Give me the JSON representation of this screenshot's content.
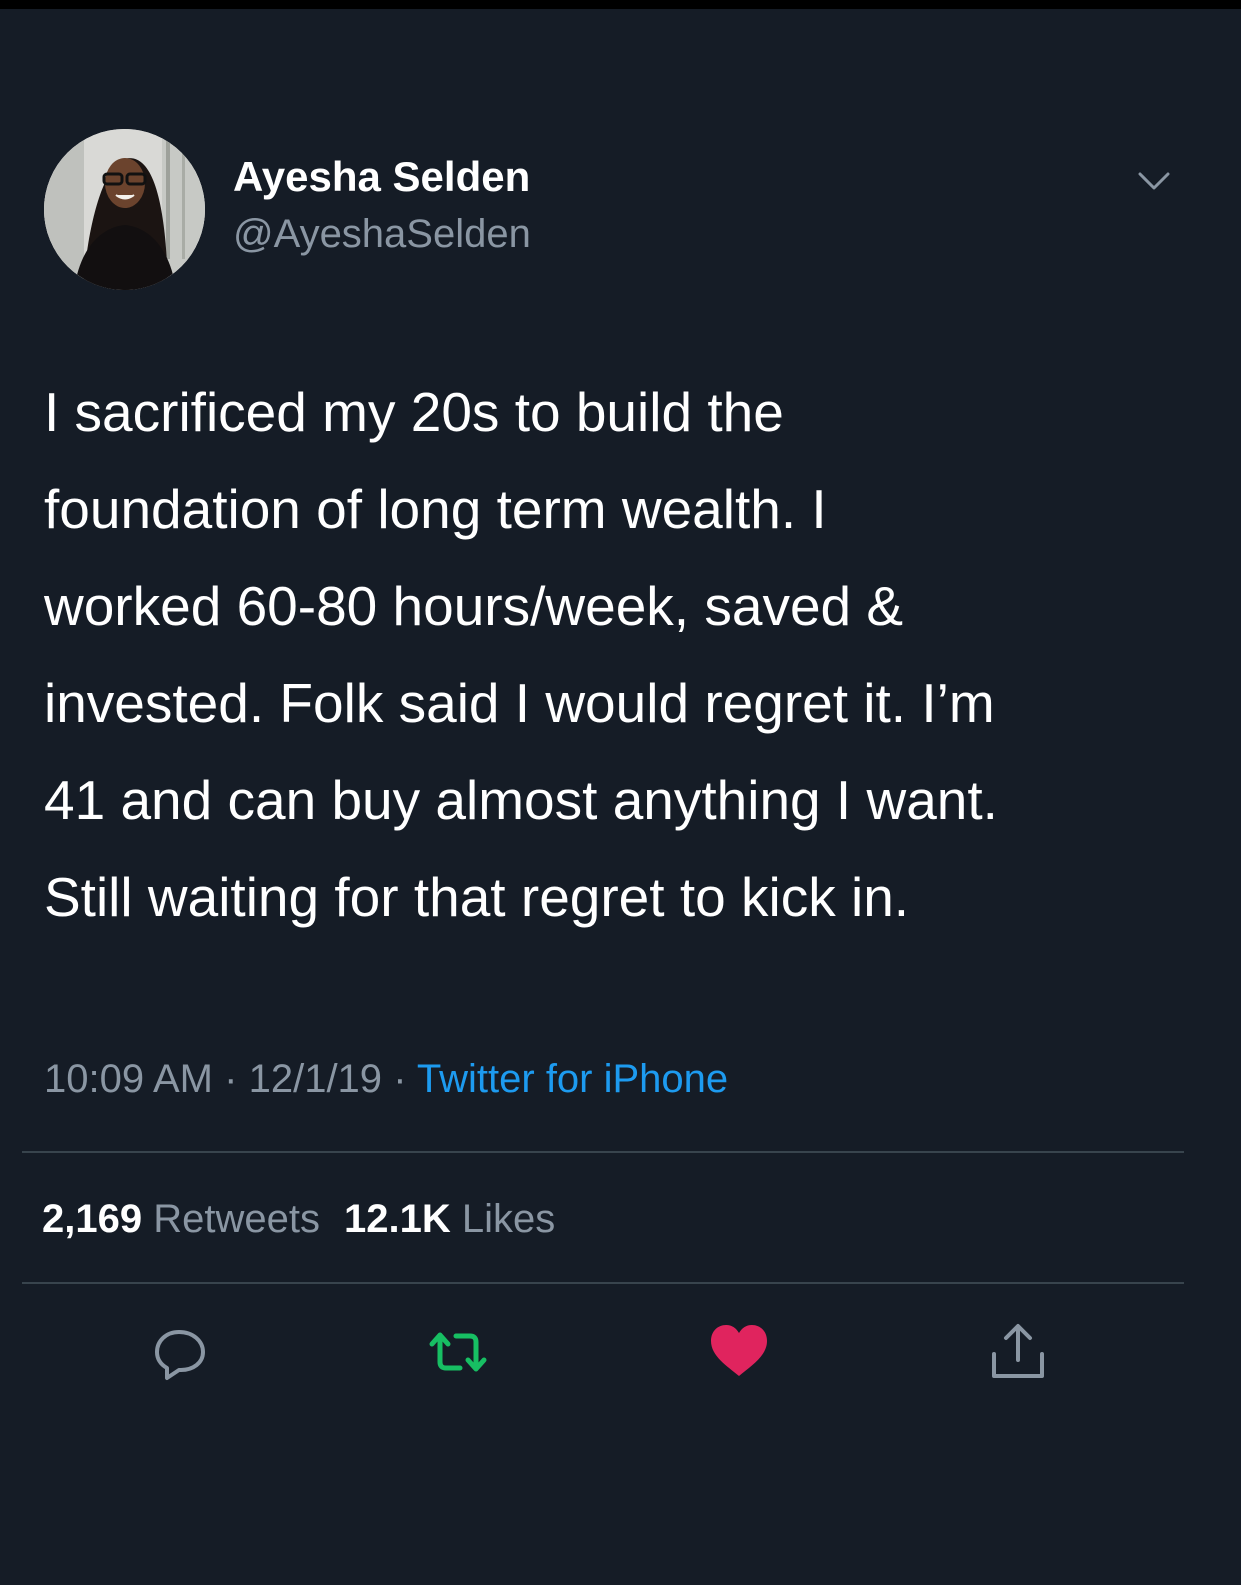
{
  "colors": {
    "background": "#151c26",
    "text_primary": "#ffffff",
    "text_secondary": "#8a96a3",
    "link_blue": "#1d9bf0",
    "retweet_green": "#17bf63",
    "like_red": "#e0245e",
    "divider": "#38444d"
  },
  "author": {
    "display_name": "Ayesha Selden",
    "handle": "@AyeshaSelden",
    "avatar_icon": "profile-photo"
  },
  "tweet": {
    "lines": [
      "I sacrificed my 20s to build the",
      "foundation of long term wealth. I",
      "worked 60-80 hours/week, saved &",
      "invested. Folk said I would regret it. I’m",
      "41 and can buy almost anything I want.",
      "Still waiting for that regret to kick in."
    ],
    "time": "10:09 AM",
    "separator": "·",
    "date": "12/1/19",
    "source": "Twitter for iPhone"
  },
  "stats": {
    "retweets_count": "2,169",
    "retweets_label": "Retweets",
    "likes_count": "12.1K",
    "likes_label": "Likes"
  },
  "actions": {
    "reply_icon": "reply-icon",
    "retweet_icon": "retweet-icon",
    "retweet_active": true,
    "like_icon": "heart-icon",
    "like_active": true,
    "share_icon": "share-icon"
  },
  "menu_icon": "chevron-down-icon"
}
